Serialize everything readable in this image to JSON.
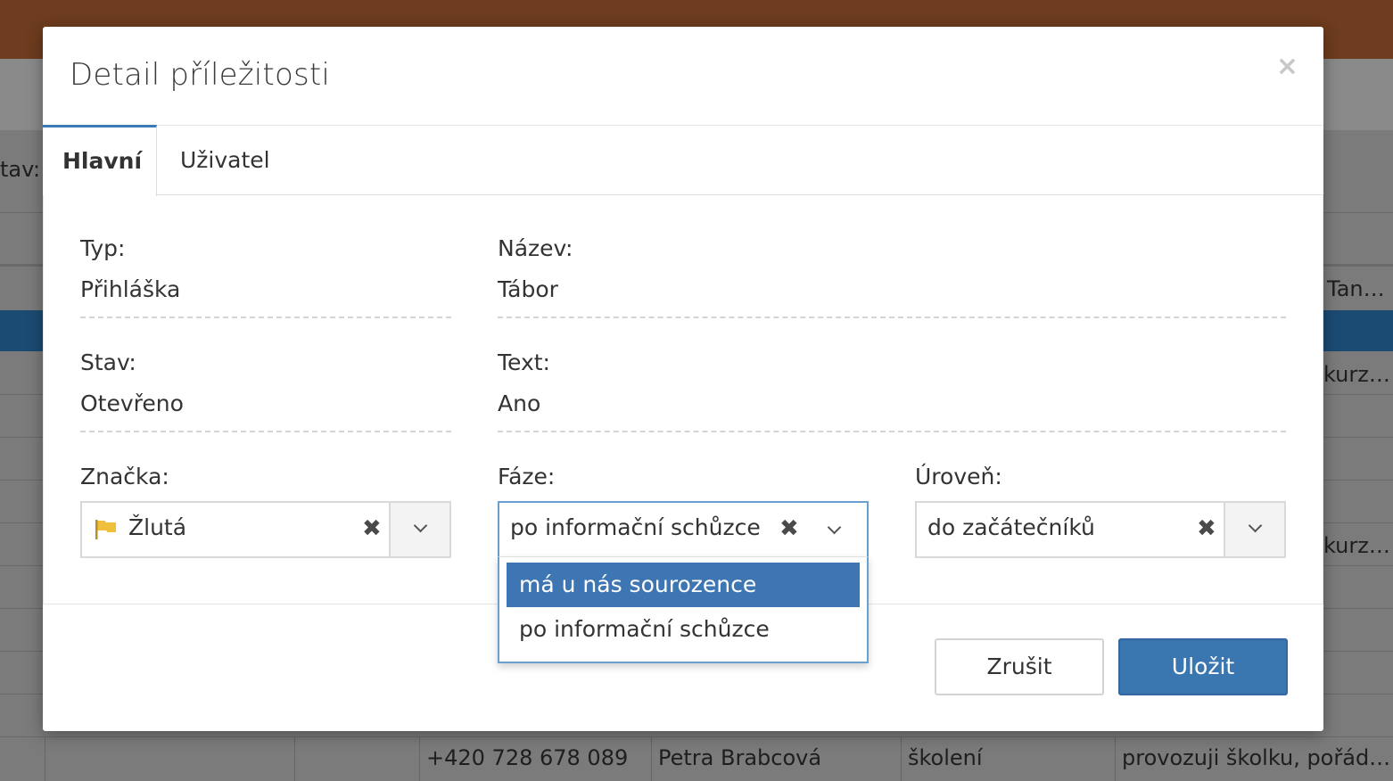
{
  "background": {
    "filter_label": "tav:",
    "row_snippets": [
      "Tan…",
      "kurz…",
      "kurz…"
    ],
    "bottom_row": {
      "phone": "+420 728 678 089",
      "name": "Petra Brabcová",
      "type": "školení",
      "note": "provozuji školku, pořád…"
    }
  },
  "modal": {
    "title": "Detail příležitosti",
    "close_symbol": "×",
    "tabs": [
      {
        "label": "Hlavní",
        "active": true
      },
      {
        "label": "Uživatel",
        "active": false
      }
    ],
    "fields": {
      "typ": {
        "label": "Typ:",
        "value": "Přihláška"
      },
      "nazev": {
        "label": "Název:",
        "value": "Tábor"
      },
      "stav": {
        "label": "Stav:",
        "value": "Otevřeno"
      },
      "text": {
        "label": "Text:",
        "value": "Ano"
      },
      "znacka": {
        "label": "Značka:",
        "value": "Žlutá",
        "icon": "flag-icon",
        "icon_color": "#f0c03c"
      },
      "faze": {
        "label": "Fáze:",
        "value": "po informační schůzce"
      },
      "uroven": {
        "label": "Úroveň:",
        "value": "do začátečníků"
      }
    },
    "clear_symbol": "✖",
    "faze_dropdown": {
      "options": [
        "má u nás sourozence",
        "po informační schůzce"
      ],
      "highlighted_index": 0
    },
    "buttons": {
      "cancel": "Zrušit",
      "save": "Uložit"
    }
  },
  "colors": {
    "accent": "#3b7bb5",
    "topbar": "#6e3c1e",
    "save_button": "#3a76b0"
  }
}
